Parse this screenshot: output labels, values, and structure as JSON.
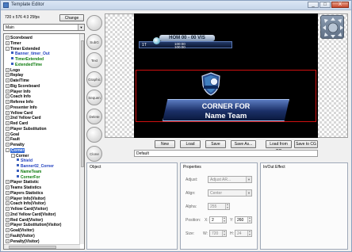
{
  "window": {
    "title": "Template Editor",
    "buttons": [
      "_",
      "□",
      "X"
    ]
  },
  "left": {
    "resolution": "720 x 576 4:3 25fps",
    "change_label": "Change",
    "template_select": "Main",
    "tree": [
      {
        "label": "Scoreboard",
        "indent": 0,
        "expander": "+",
        "style": "normal"
      },
      {
        "label": "Timer",
        "indent": 0,
        "expander": "+",
        "style": "normal"
      },
      {
        "label": "Timer Extended",
        "indent": 0,
        "expander": "-",
        "style": "normal"
      },
      {
        "label": "Banner_timer_Out",
        "indent": 1,
        "expander": "",
        "style": "blue"
      },
      {
        "label": "TimerExtended",
        "indent": 1,
        "expander": "",
        "style": "green"
      },
      {
        "label": "ExtendedTime",
        "indent": 1,
        "expander": "",
        "style": "green"
      },
      {
        "label": "Logo",
        "indent": 0,
        "expander": "+",
        "style": "normal"
      },
      {
        "label": "Replay",
        "indent": 0,
        "expander": "+",
        "style": "normal"
      },
      {
        "label": "Date/Time",
        "indent": 0,
        "expander": "+",
        "style": "normal"
      },
      {
        "label": "Big Scoreboard",
        "indent": 0,
        "expander": "+",
        "style": "normal"
      },
      {
        "label": "Player Info",
        "indent": 0,
        "expander": "+",
        "style": "normal"
      },
      {
        "label": "Coach Info",
        "indent": 0,
        "expander": "+",
        "style": "normal"
      },
      {
        "label": "Referee Info",
        "indent": 0,
        "expander": "+",
        "style": "normal"
      },
      {
        "label": "Presenter Info",
        "indent": 0,
        "expander": "+",
        "style": "normal"
      },
      {
        "label": "Yellow Card",
        "indent": 0,
        "expander": "+",
        "style": "normal"
      },
      {
        "label": "2nd Yellow Card",
        "indent": 0,
        "expander": "+",
        "style": "normal"
      },
      {
        "label": "Red Card",
        "indent": 0,
        "expander": "+",
        "style": "normal"
      },
      {
        "label": "Player Substitution",
        "indent": 0,
        "expander": "+",
        "style": "normal"
      },
      {
        "label": "Goal",
        "indent": 0,
        "expander": "+",
        "style": "normal"
      },
      {
        "label": "Fault",
        "indent": 0,
        "expander": "+",
        "style": "normal"
      },
      {
        "label": "Penalty",
        "indent": 0,
        "expander": "+",
        "style": "normal"
      },
      {
        "label": "Corner",
        "indent": 0,
        "expander": "-",
        "style": "selected"
      },
      {
        "label": "Corner",
        "indent": 1,
        "expander": "-",
        "style": "normal"
      },
      {
        "label": "Shield",
        "indent": 2,
        "expander": "",
        "style": "blue"
      },
      {
        "label": "Banner02_Corner",
        "indent": 2,
        "expander": "",
        "style": "blue"
      },
      {
        "label": "NameTeam",
        "indent": 2,
        "expander": "",
        "style": "green"
      },
      {
        "label": "CornerFor",
        "indent": 2,
        "expander": "",
        "style": "green"
      },
      {
        "label": "Player Statistic",
        "indent": 0,
        "expander": "+",
        "style": "normal"
      },
      {
        "label": "Teams Statistics",
        "indent": 0,
        "expander": "+",
        "style": "normal"
      },
      {
        "label": "Players Statistics",
        "indent": 0,
        "expander": "+",
        "style": "normal"
      },
      {
        "label": "Player Info(Visitor)",
        "indent": 0,
        "expander": "+",
        "style": "normal"
      },
      {
        "label": "Coach Info(Visitor)",
        "indent": 0,
        "expander": "+",
        "style": "normal"
      },
      {
        "label": "Yellow Card(Visitor)",
        "indent": 0,
        "expander": "+",
        "style": "normal"
      },
      {
        "label": "2nd Yellow Card(Visitor)",
        "indent": 0,
        "expander": "+",
        "style": "normal"
      },
      {
        "label": "Red Card(Visitor)",
        "indent": 0,
        "expander": "+",
        "style": "normal"
      },
      {
        "label": "Player Substitution(Visitor)",
        "indent": 0,
        "expander": "+",
        "style": "normal"
      },
      {
        "label": "Goal(Visitor)",
        "indent": 0,
        "expander": "+",
        "style": "normal"
      },
      {
        "label": "Fault(Visitor)",
        "indent": 0,
        "expander": "+",
        "style": "normal"
      },
      {
        "label": "Penalty(Visitor)",
        "indent": 0,
        "expander": "+",
        "style": "normal"
      }
    ]
  },
  "sidebar": {
    "buttons": [
      "",
      "SubG",
      "Text",
      "Graphic",
      "Sequen",
      "Delete",
      "",
      "Clone"
    ]
  },
  "preview": {
    "ticker_top": "HOM 00 - 00 VIS",
    "ticker_left": "1T",
    "ticker_right_1": "100:00",
    "ticker_right_2": "100:00",
    "corner_title": "CORNER FOR",
    "corner_team": "Name Team"
  },
  "toolbar": {
    "new": "New",
    "load": "Load",
    "save": "Save",
    "save_as": "Save As...",
    "load_from_cg": "Load from CG",
    "save_to_cg": "Save to CG"
  },
  "template_name": "Default",
  "panels": {
    "object_title": "Object",
    "properties_title": "Properties",
    "inout_title": "In/Out Effect",
    "adjust_label": "Adjust:",
    "adjust_value": "Adjust AR...",
    "align_label": "Align:",
    "align_value": "Center",
    "alpha_label": "Alpha:",
    "alpha_value": "255",
    "position_label": "Position:",
    "x_label": "X:",
    "x_value": "2",
    "y_label": "Y:",
    "y_value": "260",
    "size_label": "Size:",
    "w_label": "W:",
    "w_value": "720",
    "h_label": "H:",
    "h_value": "24"
  }
}
